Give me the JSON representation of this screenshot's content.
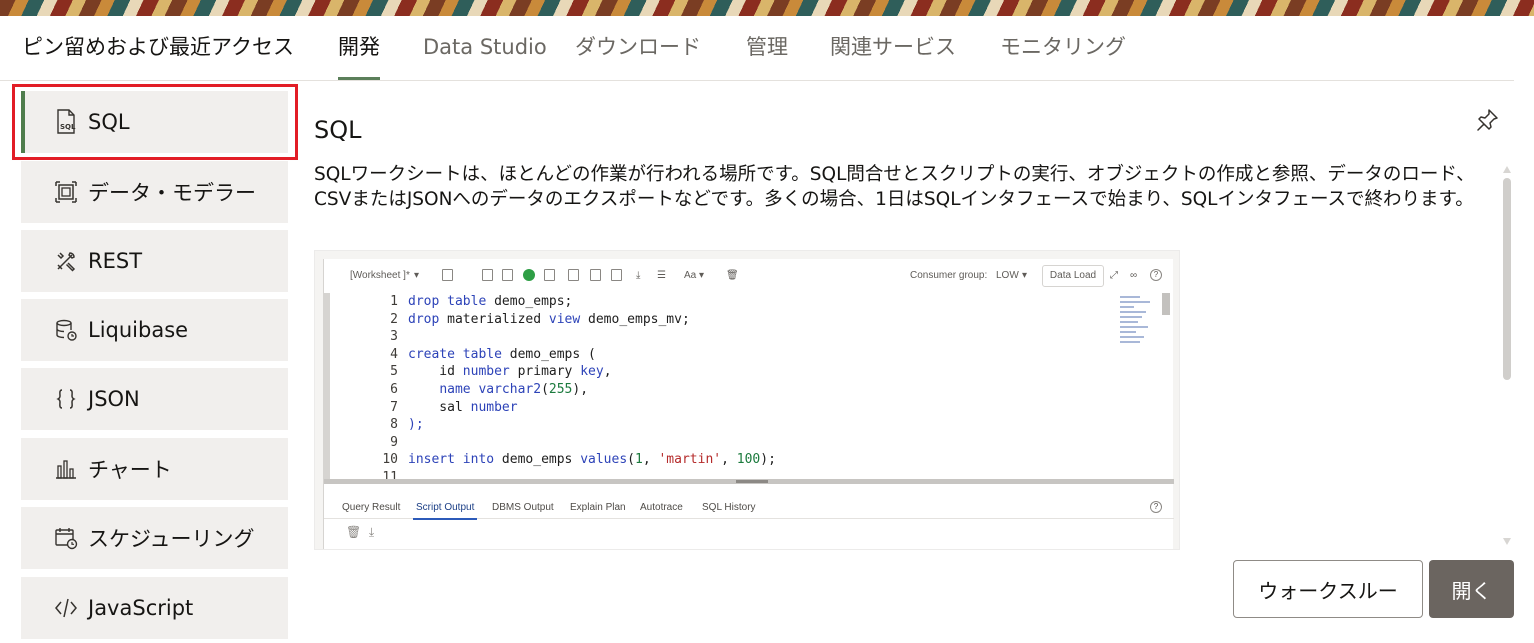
{
  "tabs": [
    {
      "label": "ピン留めおよび最近アクセス"
    },
    {
      "label": "開発"
    },
    {
      "label": "Data Studio"
    },
    {
      "label": "ダウンロード"
    },
    {
      "label": "管理"
    },
    {
      "label": "関連サービス"
    },
    {
      "label": "モニタリング"
    }
  ],
  "active_tab": "開発",
  "sidebar": {
    "items": [
      {
        "label": "SQL",
        "icon": "sql-file-icon"
      },
      {
        "label": "データ・モデラー",
        "icon": "data-modeler-icon"
      },
      {
        "label": "REST",
        "icon": "rest-tools-icon"
      },
      {
        "label": "Liquibase",
        "icon": "liquibase-icon"
      },
      {
        "label": "JSON",
        "icon": "json-braces-icon"
      },
      {
        "label": "チャート",
        "icon": "chart-icon"
      },
      {
        "label": "スケジューリング",
        "icon": "calendar-clock-icon"
      },
      {
        "label": "JavaScript",
        "icon": "code-icon"
      }
    ],
    "active": "SQL"
  },
  "content": {
    "title": "SQL",
    "description": "SQLワークシートは、ほとんどの作業が行われる場所です。SQL問合せとスクリプトの実行、オブジェクトの作成と参照、データのロード、CSVまたはJSONへのデータのエクスポートなどです。多くの場合、1日はSQLインタフェースで始まり、SQLインタフェースで終わります。"
  },
  "screenshot": {
    "worksheet_label": "[Worksheet ]*",
    "consumer_group_label": "Consumer group:",
    "consumer_group_value": "LOW",
    "data_load_label": "Data Load",
    "code_lines": [
      {
        "n": "1",
        "text": "drop table demo_emps;"
      },
      {
        "n": "2",
        "text": "drop materialized view demo_emps_mv;"
      },
      {
        "n": "3",
        "text": ""
      },
      {
        "n": "4",
        "text": "create table demo_emps ("
      },
      {
        "n": "5",
        "text": "    id number primary key,"
      },
      {
        "n": "6",
        "text": "    name varchar2(255),"
      },
      {
        "n": "7",
        "text": "    sal number"
      },
      {
        "n": "8",
        "text": ");"
      },
      {
        "n": "9",
        "text": ""
      },
      {
        "n": "10",
        "text": "insert into demo_emps values(1, 'martin', 100);"
      },
      {
        "n": "11",
        "text": ""
      }
    ],
    "output_tabs": [
      "Query Result",
      "Script Output",
      "DBMS Output",
      "Explain Plan",
      "Autotrace",
      "SQL History"
    ],
    "active_output_tab": "Script Output"
  },
  "buttons": {
    "walkthrough": "ウォークスルー",
    "open": "開く"
  },
  "colors": {
    "accent": "#4f7d4d",
    "highlight": "#e21d26",
    "primary_button": "#6b6560"
  }
}
